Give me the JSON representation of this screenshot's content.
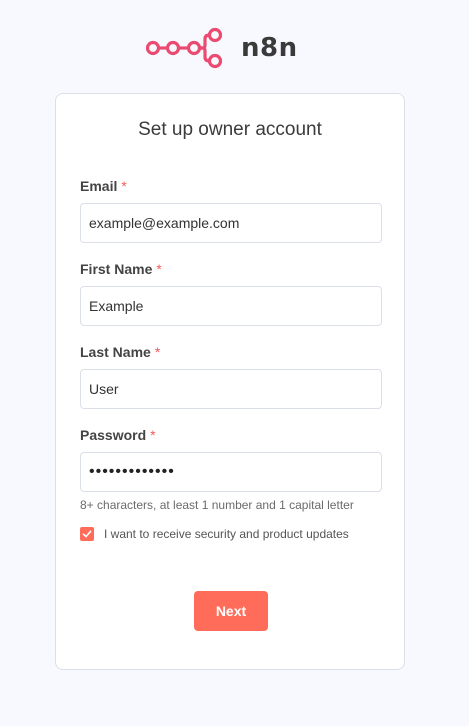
{
  "brand": {
    "name": "n8n",
    "logo_icon": "n8n-logo-icon",
    "accent_color": "#ea4b71"
  },
  "form": {
    "title": "Set up owner account",
    "required_marker": "*",
    "fields": [
      {
        "label": "Email",
        "value": "example@example.com",
        "type": "email"
      },
      {
        "label": "First Name",
        "value": "Example",
        "type": "text"
      },
      {
        "label": "Last Name",
        "value": "User",
        "type": "text"
      },
      {
        "label": "Password",
        "value": "•••••••••••••",
        "type": "password"
      }
    ],
    "password_hint": "8+ characters, at least 1 number and 1 capital letter",
    "updates_checkbox": {
      "label": "I want to receive security and product updates",
      "checked": true
    },
    "submit_label": "Next",
    "primary_color": "#ff6d5a"
  }
}
